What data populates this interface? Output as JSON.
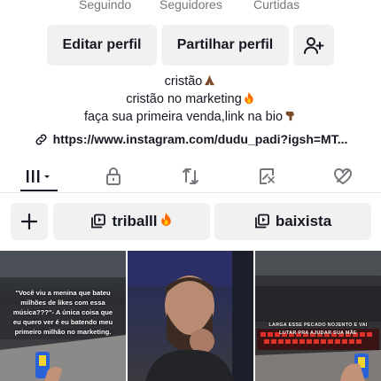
{
  "stats": {
    "following_label": "Seguindo",
    "followers_label": "Seguidores",
    "likes_label": "Curtidas"
  },
  "actions": {
    "edit_profile": "Editar perfil",
    "share_profile": "Partilhar perfil"
  },
  "bio": {
    "line1": "cristão",
    "line2": "cristão no marketing",
    "line3": "faça sua primeira venda,link na bio",
    "link": "https://www.instagram.com/dudu_padi?igsh=MT..."
  },
  "tabs": [
    {
      "icon": "grid-icon",
      "active": true
    },
    {
      "icon": "lock-icon",
      "active": false
    },
    {
      "icon": "repost-icon",
      "active": false
    },
    {
      "icon": "favorites-icon",
      "active": false
    },
    {
      "icon": "liked-icon",
      "active": false
    }
  ],
  "playlists": {
    "add_icon": "plus-icon",
    "items": [
      {
        "label": "triballl",
        "icon": "playlist-icon"
      },
      {
        "label": "baixista",
        "icon": "playlist-icon"
      }
    ]
  },
  "videos": [
    {
      "caption": "\"Você viu a menina que bateu milhões de likes com essa música???\"- A única coisa que eu quero ver é eu batendo meu primeiro milhão no marketing."
    },
    {
      "caption": ""
    },
    {
      "caption": "LARGA ESSE PECADO NOJENTO E VAI LUTAR PRA AJUDAR SUA MÃE"
    }
  ],
  "colors": {
    "text": "#161823",
    "muted": "#75777c",
    "button_bg": "#f1f1f2",
    "fire": "#ff6a00"
  }
}
